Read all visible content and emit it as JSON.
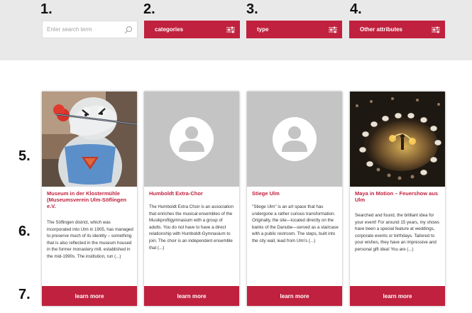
{
  "steps": [
    "1.",
    "2.",
    "3.",
    "4.",
    "5.",
    "6.",
    "7."
  ],
  "search": {
    "placeholder": "Enter search term"
  },
  "filters": [
    {
      "label": "categories"
    },
    {
      "label": "type"
    },
    {
      "label": "Other attributes"
    }
  ],
  "cards": [
    {
      "image": "museum-figure-photo",
      "title": "Museum in der Klostermühle (Museumsverein Ulm-Söflingen e.V.",
      "description": "The Söflingen district, which was incorporated into Ulm in 1905, has managed to preserve much of its identity – something that is also reflected in the museum housed in the former monastery mill, established in the mid-1990s. The institution, run (...)",
      "button": "learn more"
    },
    {
      "image": "user-placeholder-icon",
      "title": "Humboldt Extra-Chor",
      "description": "The Humboldt Extra Choir is an association that enriches the musical ensembles of the Musikprofilgymnasium with a group of adults. You do not have to have a direct relationship with Humboldt-Gymnasium to join. The choir is an independent ensemble that (...)",
      "button": "learn more"
    },
    {
      "image": "user-placeholder-icon",
      "title": "Stiege Ulm",
      "description": "\"Stiege Ulm\" is an art space that has undergone a rather curious transformation. Originally, the site—located directly on the banks of the Danube—served as a staircase with a public restroom. The steps, built into the city wall, lead from Ulm's (...)",
      "button": "learn more"
    },
    {
      "image": "fire-show-photo",
      "title": "Maya in Motion – Feuershow aus Ulm",
      "description": "Searched and found, the brilliant idea for your event! For around 15 years, my shows have been a special feature at weddings, corporate events or birthdays. Tailored to your wishes, they have an impressive and personal gift idea! You are (...)",
      "button": "learn more"
    }
  ],
  "colors": {
    "accent": "#c0213e",
    "band": "#e9e9e9",
    "placeholder": "#c4c4c4"
  }
}
